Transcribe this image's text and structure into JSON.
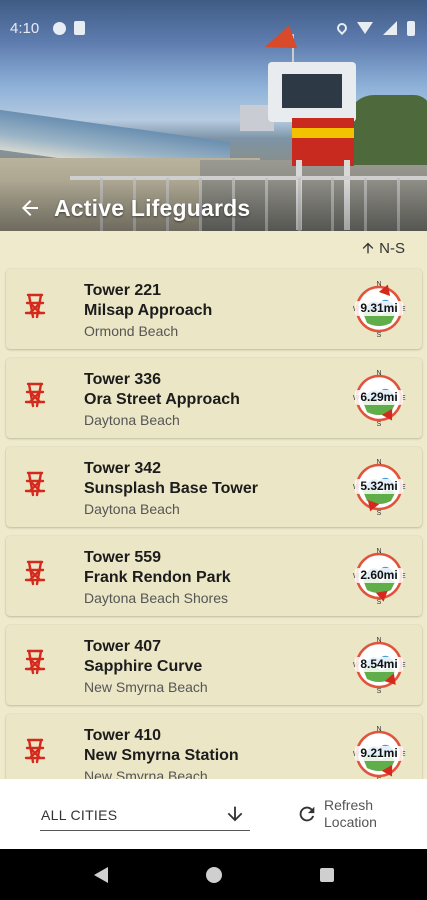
{
  "status_bar": {
    "time": "4:10",
    "icons": [
      "notification-icon",
      "sd-card-icon",
      "location-icon",
      "wifi-icon",
      "cell-signal-icon",
      "battery-icon"
    ]
  },
  "header": {
    "title": "Active Lifeguards",
    "back_icon": "arrow-left-icon"
  },
  "sort": {
    "label": "N-S",
    "icon": "arrow-up-icon"
  },
  "towers": [
    {
      "name": "Tower 221",
      "location": "Milsap Approach",
      "city": "Ormond Beach",
      "distance": "9.31mi",
      "bearing_deg": 20
    },
    {
      "name": "Tower 336",
      "location": "Ora Street Approach",
      "city": "Daytona Beach",
      "distance": "6.29mi",
      "bearing_deg": 150
    },
    {
      "name": "Tower 342",
      "location": "Sunsplash Base Tower",
      "city": "Daytona Beach",
      "distance": "5.32mi",
      "bearing_deg": 200
    },
    {
      "name": "Tower 559",
      "location": "Frank Rendon Park",
      "city": "Daytona Beach Shores",
      "distance": "2.60mi",
      "bearing_deg": 170
    },
    {
      "name": "Tower 407",
      "location": "Sapphire Curve",
      "city": "New Smyrna Beach",
      "distance": "8.54mi",
      "bearing_deg": 140
    },
    {
      "name": "Tower 410",
      "location": "New Smyrna Station",
      "city": "New Smyrna Beach",
      "distance": "9.21mi",
      "bearing_deg": 150
    }
  ],
  "compass_labels": {
    "n": "N",
    "s": "S",
    "e": "E",
    "w": "W"
  },
  "colors": {
    "accent": "#d42a1e",
    "background": "#eeeacb",
    "card": "#ebe6c6"
  },
  "bottom_bar": {
    "city_filter": "ALL CITIES",
    "refresh_label": "Refresh Location"
  }
}
